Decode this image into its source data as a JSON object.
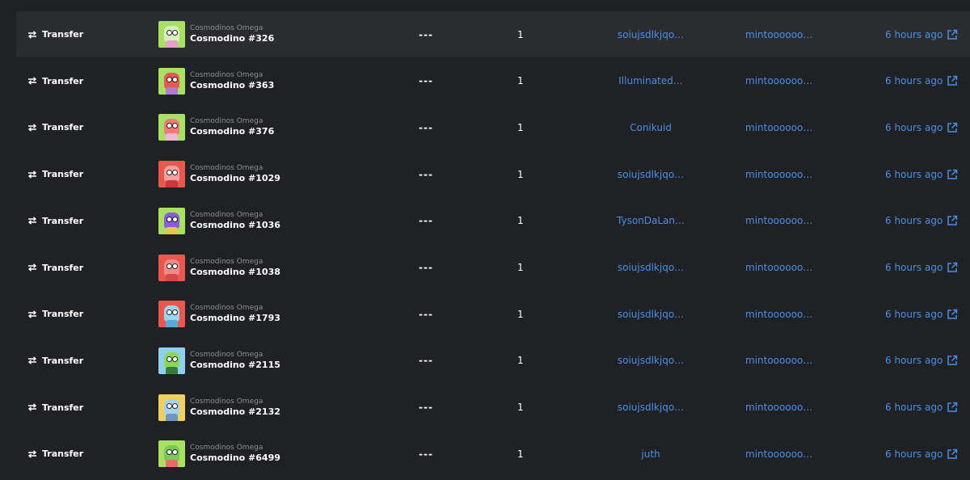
{
  "colors": {
    "background": "#202124",
    "row_hover": "#2b2c30",
    "link": "#4a8fe7",
    "text": "#ffffff",
    "muted": "#8e8f94"
  },
  "rows": [
    {
      "event": "Transfer",
      "collection": "Cosmodinos Omega",
      "name": "Cosmodino #326",
      "price": "---",
      "quantity": "1",
      "from": "soiujsdlkjqo…",
      "to": "mintoooooo…",
      "time": "6 hours ago",
      "thumb_bg": "#a8e063",
      "head": "#d8f0c0",
      "body": "#e4a0c8"
    },
    {
      "event": "Transfer",
      "collection": "Cosmodinos Omega",
      "name": "Cosmodino #363",
      "price": "---",
      "quantity": "1",
      "from": "Illuminated…",
      "to": "mintoooooo…",
      "time": "6 hours ago",
      "thumb_bg": "#a8e063",
      "head": "#e8584e",
      "body": "#b07ad0"
    },
    {
      "event": "Transfer",
      "collection": "Cosmodinos Omega",
      "name": "Cosmodino #376",
      "price": "---",
      "quantity": "1",
      "from": "Conikuid",
      "to": "mintoooooo…",
      "time": "6 hours ago",
      "thumb_bg": "#a8e063",
      "head": "#f07a7a",
      "body": "#f0b8d0"
    },
    {
      "event": "Transfer",
      "collection": "Cosmodinos Omega",
      "name": "Cosmodino #1029",
      "price": "---",
      "quantity": "1",
      "from": "soiujsdlkjqo…",
      "to": "mintoooooo…",
      "time": "6 hours ago",
      "thumb_bg": "#e8584e",
      "head": "#f5a0a0",
      "body": "#c83a3a"
    },
    {
      "event": "Transfer",
      "collection": "Cosmodinos Omega",
      "name": "Cosmodino #1036",
      "price": "---",
      "quantity": "1",
      "from": "TysonDaLan…",
      "to": "mintoooooo…",
      "time": "6 hours ago",
      "thumb_bg": "#a8e063",
      "head": "#8a5cd8",
      "body": "#e8c84a"
    },
    {
      "event": "Transfer",
      "collection": "Cosmodinos Omega",
      "name": "Cosmodino #1038",
      "price": "---",
      "quantity": "1",
      "from": "soiujsdlkjqo…",
      "to": "mintoooooo…",
      "time": "6 hours ago",
      "thumb_bg": "#e8584e",
      "head": "#f08a8a",
      "body": "#d84848"
    },
    {
      "event": "Transfer",
      "collection": "Cosmodinos Omega",
      "name": "Cosmodino #1793",
      "price": "---",
      "quantity": "1",
      "from": "soiujsdlkjqo…",
      "to": "mintoooooo…",
      "time": "6 hours ago",
      "thumb_bg": "#e8584e",
      "head": "#9ad8e8",
      "body": "#5aa8d8"
    },
    {
      "event": "Transfer",
      "collection": "Cosmodinos Omega",
      "name": "Cosmodino #2115",
      "price": "---",
      "quantity": "1",
      "from": "soiujsdlkjqo…",
      "to": "mintoooooo…",
      "time": "6 hours ago",
      "thumb_bg": "#8fd0f0",
      "head": "#8ad85a",
      "body": "#3a7a3a"
    },
    {
      "event": "Transfer",
      "collection": "Cosmodinos Omega",
      "name": "Cosmodino #2132",
      "price": "---",
      "quantity": "1",
      "from": "soiujsdlkjqo…",
      "to": "mintoooooo…",
      "time": "6 hours ago",
      "thumb_bg": "#f0d060",
      "head": "#a8d0e8",
      "body": "#6a98c0"
    },
    {
      "event": "Transfer",
      "collection": "Cosmodinos Omega",
      "name": "Cosmodino #6499",
      "price": "---",
      "quantity": "1",
      "from": "juth",
      "to": "mintoooooo…",
      "time": "6 hours ago",
      "thumb_bg": "#a8e063",
      "head": "#7ac85a",
      "body": "#e86a6a"
    }
  ]
}
